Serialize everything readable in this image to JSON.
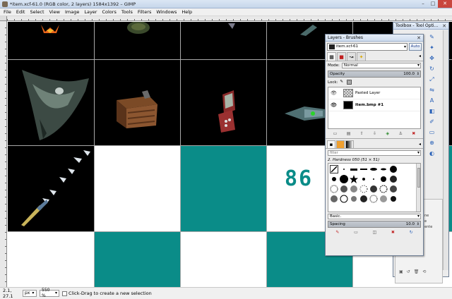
{
  "window": {
    "title": "*item.xcf-61.0 (RGB color, 2 layers) 1584x1392 – GIMP",
    "controls": {
      "minimize": "–",
      "maximize": "□",
      "close": "✕"
    }
  },
  "menubar": {
    "items": [
      "File",
      "Edit",
      "Select",
      "View",
      "Image",
      "Layer",
      "Colors",
      "Tools",
      "Filters",
      "Windows",
      "Help"
    ]
  },
  "canvas": {
    "teal_text": "86 l",
    "colors": {
      "teal": "#0a8c88",
      "black": "#000000",
      "white": "#ffffff"
    }
  },
  "statusbar": {
    "coords": "2.1, 27.1",
    "unit": "px",
    "zoom": "550 %",
    "hint": "Click-Drag to create a new selection"
  },
  "layers_dock": {
    "title": "Layers - Brushes",
    "image_select": "item.xcf-61",
    "auto_label": "Auto",
    "mode_label": "Mode:",
    "mode_value": "Normal",
    "opacity_label": "Opacity",
    "opacity_value": "100.0",
    "lock_label": "Lock:",
    "layers": [
      {
        "name": "Pasted Layer",
        "visible": true
      },
      {
        "name": "item.bmp #1",
        "visible": true
      }
    ],
    "filter_placeholder": "filter",
    "brush_name": "2. Hardness 050 (51 × 51)",
    "brush_category": "Basic.",
    "spacing_label": "Spacing",
    "spacing_value": "10.0"
  },
  "toolbox": {
    "title": "Toolbox - Tool Opti...",
    "labels": [
      "ne",
      "e",
      "ente"
    ]
  }
}
